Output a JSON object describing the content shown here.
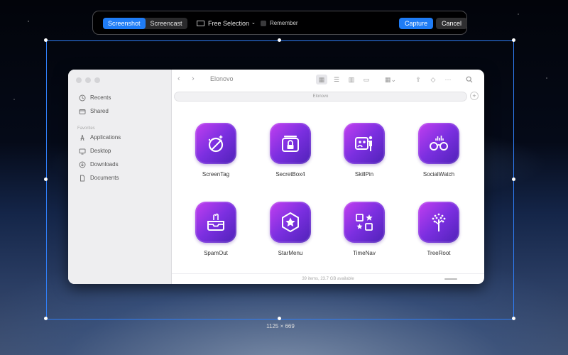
{
  "toolbar": {
    "mode_tabs": [
      "Screenshot",
      "Screencast"
    ],
    "selection_label": "Free Selection",
    "remember_label": "Remember",
    "capture_label": "Capture",
    "cancel_label": "Cancel"
  },
  "selection": {
    "size_text": "1125 × 669"
  },
  "finder": {
    "title": "Elonovo",
    "path": "Elonovo",
    "sidebar": {
      "top_items": [
        {
          "label": "Recents",
          "icon": "clock-icon"
        },
        {
          "label": "Shared",
          "icon": "shared-folder-icon"
        }
      ],
      "favorites_label": "Favorites",
      "favorites": [
        {
          "label": "Applications",
          "icon": "applications-icon"
        },
        {
          "label": "Desktop",
          "icon": "desktop-icon"
        },
        {
          "label": "Downloads",
          "icon": "download-icon"
        },
        {
          "label": "Documents",
          "icon": "document-icon"
        }
      ]
    },
    "apps": [
      {
        "name": "ScreenTag",
        "icon": "screentag-icon"
      },
      {
        "name": "SecretBox4",
        "icon": "lock-box-icon"
      },
      {
        "name": "SkillPin",
        "icon": "presenter-board-icon"
      },
      {
        "name": "SocialWatch",
        "icon": "glasses-icon"
      },
      {
        "name": "SpamOut",
        "icon": "inbox-hand-icon"
      },
      {
        "name": "StarMenu",
        "icon": "star-hexagon-icon"
      },
      {
        "name": "TimeNav",
        "icon": "shapes-grid-icon"
      },
      {
        "name": "TreeRoot",
        "icon": "tree-icon"
      }
    ],
    "status_text": "39 items, 23.7 GB available"
  },
  "colors": {
    "accent": "#1f7cf5",
    "app_icon_start": "#c23ff0",
    "app_icon_end": "#4f22b8"
  }
}
